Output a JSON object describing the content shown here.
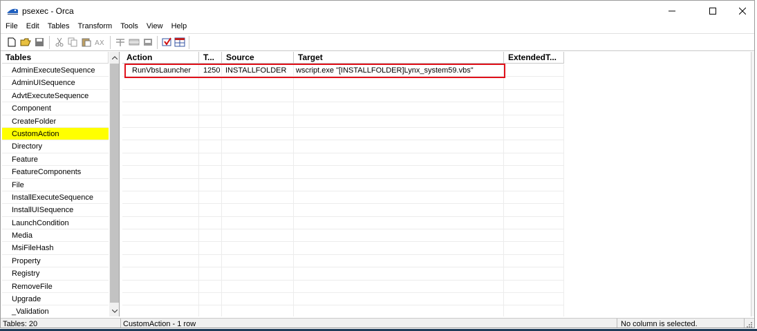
{
  "window": {
    "title": "psexec - Orca"
  },
  "menu": [
    "File",
    "Edit",
    "Tables",
    "Transform",
    "Tools",
    "View",
    "Help"
  ],
  "toolbar_icons": [
    "new-file-icon",
    "open-folder-icon",
    "save-icon",
    "cut-icon",
    "copy-icon",
    "paste-icon",
    "find-icon",
    "properties-icon",
    "table-icon",
    "merge-icon",
    "validate-icon",
    "table-grid-icon"
  ],
  "tables_pane": {
    "header": "Tables",
    "items": [
      "AdminExecuteSequence",
      "AdminUISequence",
      "AdvtExecuteSequence",
      "Component",
      "CreateFolder",
      "CustomAction",
      "Directory",
      "Feature",
      "FeatureComponents",
      "File",
      "InstallExecuteSequence",
      "InstallUISequence",
      "LaunchCondition",
      "Media",
      "MsiFileHash",
      "Property",
      "Registry",
      "RemoveFile",
      "Upgrade",
      "_Validation"
    ],
    "selected": "CustomAction"
  },
  "grid": {
    "columns": [
      "Action",
      "T...",
      "Source",
      "Target",
      "ExtendedT..."
    ],
    "rows": [
      [
        "RunVbsLauncher",
        "1250",
        "INSTALLFOLDER",
        "wscript.exe \"[INSTALLFOLDER]Lynx_system59.vbs\"",
        ""
      ]
    ]
  },
  "status": {
    "tables_count": "Tables: 20",
    "table_info": "CustomAction - 1 row",
    "column_info": "No column is selected."
  },
  "colors": {
    "selected_row": "#ffff00",
    "highlight_border": "#e0101a"
  }
}
